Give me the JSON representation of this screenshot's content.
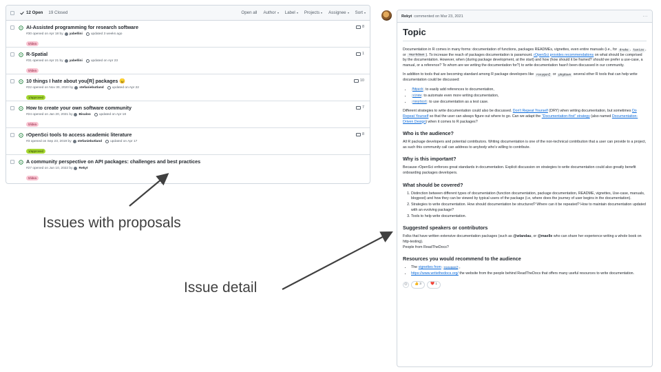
{
  "list": {
    "open_label": "12 Open",
    "closed_label": "19 Closed",
    "filters": [
      "Open all",
      "Author",
      "Label",
      "Projects",
      "Assignee",
      "Sort"
    ],
    "issues": [
      {
        "title": "AI-Assisted programming for research software",
        "meta_opened": "#30 opened on Apr 18 by",
        "author": "yabellini",
        "updated": "updated 3 weeks ago",
        "label": "0/idea",
        "label_color": "#f9c4d2",
        "label_text_color": "#8a1c3a",
        "comments": "8"
      },
      {
        "title": "R-Spatial",
        "meta_opened": "#31 opened on Apr 21 by",
        "author": "yabellini",
        "updated": "updated on Apr 23",
        "label": "0/idea",
        "label_color": "#f9c4d2",
        "label_text_color": "#8a1c3a",
        "comments": "1"
      },
      {
        "title": "10 things I hate about you[R] packages 😠",
        "meta_opened": "#22 opened on Nov 30, 2020 by",
        "author": "stefaniebutland",
        "updated": "updated on Apr 22",
        "label": "1/approved",
        "label_color": "#a6d833",
        "label_text_color": "#2b3a00",
        "comments": "10"
      },
      {
        "title": "How to create your own software community",
        "meta_opened": "#24 opened on Jan 20, 2021 by",
        "author": "Bisaloo",
        "updated": "updated on Apr 18",
        "label": "0/idea",
        "label_color": "#f9c4d2",
        "label_text_color": "#8a1c3a",
        "comments": "7"
      },
      {
        "title": "rOpenSci tools to access academic literature",
        "meta_opened": "#3 opened on Sep 23, 2019 by",
        "author": "stefaniebutland",
        "updated": "updated on Apr 17",
        "label": "1/approved",
        "label_color": "#a6d833",
        "label_text_color": "#2b3a00",
        "comments": "8"
      },
      {
        "title": "A community perspective on API packages: challenges and best practices",
        "meta_opened": "#27 opened on Jun 10, 2022 by",
        "author": "Rekyt",
        "updated": "",
        "label": "0/idea",
        "label_color": "#f9c4d2",
        "label_text_color": "#8a1c3a",
        "comments": ""
      }
    ]
  },
  "annotations": {
    "proposals": "Issues with proposals",
    "detail": "Issue detail"
  },
  "detail": {
    "author": "Rekyt",
    "commented": "commented on Mar 23, 2021",
    "menu": "···",
    "title": "Topic",
    "intro_p1_a": "Documentation in R comes in many forms: documentation of functions, packages READMEs, vignettes, even entire manuals (i.e., for",
    "intro_code1": "drake",
    "intro_code2": "taxize",
    "intro_or": "or",
    "intro_code3": "rmarkdown",
    "intro_p1_b": "). To increase the reach of packages documentation is paramount.",
    "intro_link": "rOpenSci provides recommendations",
    "intro_p1_c": "on what should be comprised by the documentation. However, when (during package development, at the start) and how (how should it be framed? should we prefer a use-case, a manual, or a reference? To whom are we writing the documentation for?) to write documentation hasn't been discussed in our community.",
    "tools_p_a": "In addition to tools that are becoming standard among R package developers like",
    "tools_code1": "roxygen2",
    "tools_or": "or",
    "tools_code2": "pkgdown",
    "tools_p_b": "several other R tools that can help write documentation could be discussed:",
    "tools": [
      {
        "code": "Rdpack",
        "text": "to easily add references to documentation,"
      },
      {
        "code": "sinew",
        "text": "to automate even more writing documentation,"
      },
      {
        "code": "roxytest",
        "text": "to use documentation as a test case."
      }
    ],
    "strat_a": "Different strategies to write documentation could also be discussed.",
    "strat_l1": "Don't Repeat Yourself",
    "strat_b": "(DRY) when writing documentation, but sometimes",
    "strat_l2": "Do Repeat Yourself",
    "strat_c": "so that the user can always figure out where to go. Can we adapt the",
    "strat_l3": "\"Documentation-first\" strategy",
    "strat_d": "(also named",
    "strat_l4": "Documentation-Driven Design",
    "strat_e": ") when it comes to R packages?",
    "h_audience": "Who is the audience?",
    "audience": "All R package developers and potential contributors. Writing documentation is one of the non-technical contribution that a user can provide to a project, as such this community call can address to anybody who's willing to contribute.",
    "h_why": "Why is this important?",
    "why": "Because rOpenSci enforces great standards in documentation. Explicit discussion on strategies to write documentation could also greatly benefit onboarding packages developers.",
    "h_covered": "What should be covered?",
    "covered": [
      "Distinction between different types of documentation (function documentation, package documentation, README, vignettes, Use-case, manuals, blogpost) and how they can be viewed by typical users of the package (i.e, where does the journey of user begins in the documentation).",
      "Strategies to write documentation. How should documentation be structured? Where can it be repeated? How to maintain documentation updated with an evolving package?",
      "Tools to help write documentation."
    ],
    "h_speakers": "Suggested speakers or contributors",
    "speakers_a": "Folks that have written extensive documentation packages (such as",
    "speakers_u1": "@wlandau",
    "speakers_or": ", or",
    "speakers_u2": "@maelle",
    "speakers_b": "who can share her experience writing a whole book on http-testing).",
    "speakers_c": "People from ReadTheDocs?",
    "h_resources": "Resources you would recommend to the audience",
    "res1_a": "The",
    "res1_link": "vignettes from",
    "res1_code": "roxygen2",
    "res1_b": ",",
    "res2_link": "https://www.writethedocs.org/",
    "res2_b": "the website from the people behind ReadTheDocs that offers many useful resources to write documentation.",
    "reaction_add": "☺",
    "reaction_thumbs": "👍 3",
    "reaction_heart": "❤️ 1"
  }
}
